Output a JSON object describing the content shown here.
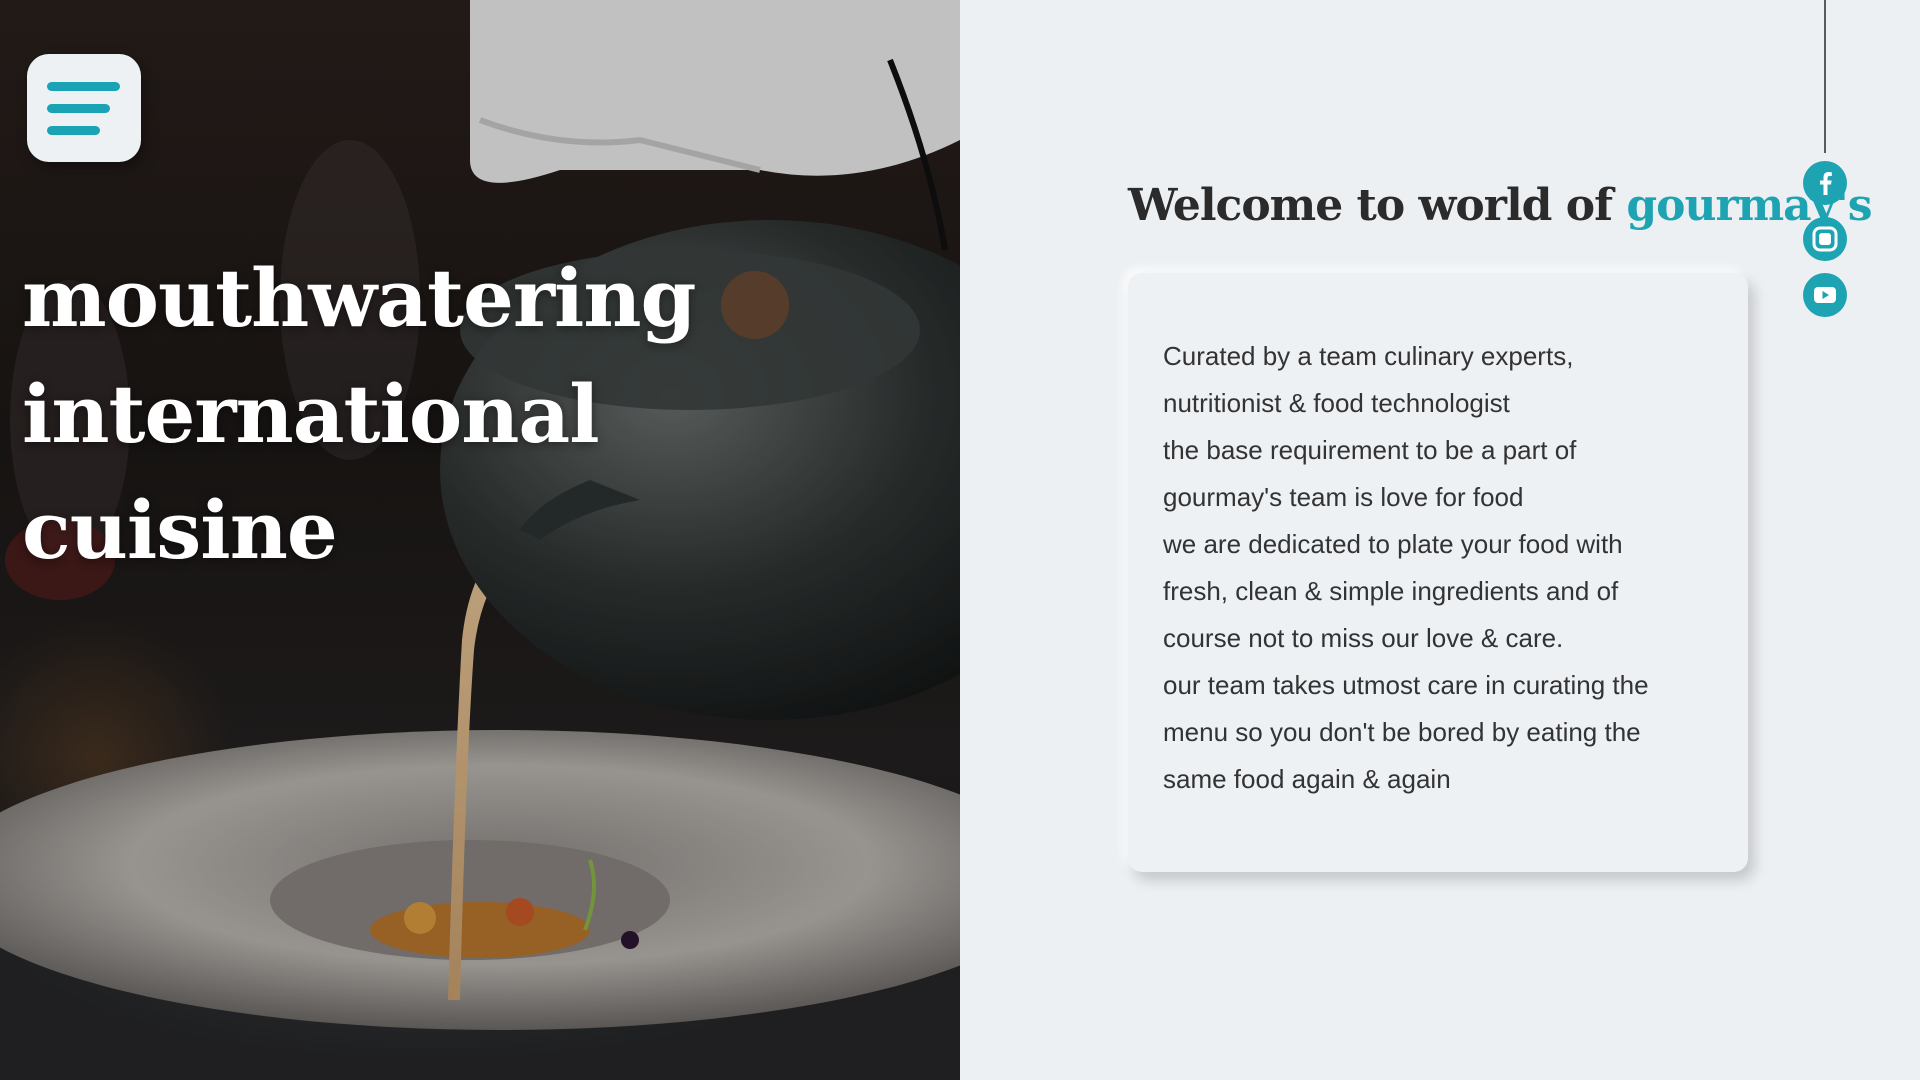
{
  "hero": {
    "title_line1": "mouthwatering",
    "title_line2": "international cuisine"
  },
  "menu": {
    "icon": "hamburger-menu-icon"
  },
  "welcome": {
    "prefix": "Welcome to world of ",
    "brand": "gourmay's"
  },
  "about": {
    "lines": [
      "Curated by a team culinary experts,",
      "nutritionist & food technologist",
      "the base requirement to be a part of",
      "gourmay's team is love for food",
      "we are dedicated to plate your food with",
      "fresh, clean & simple ingredients and of",
      "course not to miss our love & care.",
      "our team takes utmost care in curating the",
      "menu so you don't be bored by eating the",
      "same food again & again"
    ]
  },
  "social": [
    {
      "name": "facebook",
      "icon": "facebook-icon"
    },
    {
      "name": "instagram",
      "icon": "instagram-icon"
    },
    {
      "name": "youtube",
      "icon": "youtube-icon"
    }
  ],
  "colors": {
    "accent": "#1ea3b3",
    "background": "#edf0f3",
    "text": "#333333"
  }
}
